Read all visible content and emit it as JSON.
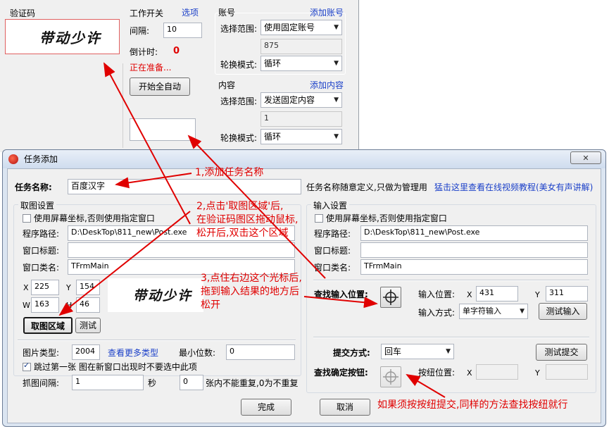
{
  "background_window": {
    "captcha_label": "验证码",
    "work_switch_label": "工作开关",
    "options_link": "选项",
    "interval_label": "间隔:",
    "interval_value": "10",
    "countdown_label": "倒计时:",
    "countdown_value": "0",
    "status_text": "正在准备...",
    "start_button": "开始全自动",
    "account_group": "账号",
    "add_account_link": "添加账号",
    "account_scope_label": "选择范围:",
    "account_scope_value": "使用固定账号",
    "account_value": "875",
    "account_rotate_label": "轮换模式:",
    "account_rotate_value": "循环",
    "content_group": "内容",
    "add_content_link": "添加内容",
    "content_scope_label": "选择范围:",
    "content_scope_value": "发送固定内容",
    "content_value": "1",
    "content_rotate_label": "轮换模式:",
    "content_rotate_value": "循环",
    "captcha_text": "带动少许"
  },
  "dialog": {
    "title": "任务添加",
    "close_glyph": "✕",
    "task_name_label": "任务名称:",
    "task_name_value": "百度汉字",
    "task_name_hint": "任务名称随意定义,只做为管理用",
    "video_link": "猛击这里查看在线视频教程(美女有声讲解)",
    "capture": {
      "group_title": "取图设置",
      "use_screen_coords": "使用屏幕坐标,否则使用指定窗口",
      "program_path_label": "程序路径:",
      "program_path_value": "D:\\DeskTop\\811_new\\Post.exe",
      "window_title_label": "窗口标题:",
      "window_title_value": "",
      "window_class_label": "窗口类名:",
      "window_class_value": "TFrmMain",
      "x_label": "X",
      "x_value": "225",
      "y_label": "Y",
      "y_value": "154",
      "w_label": "W",
      "w_value": "163",
      "h_label": "H",
      "h_value": "46",
      "capture_button": "取图区域",
      "test_button": "测试",
      "image_type_label": "图片类型:",
      "image_type_value": "2004",
      "more_types_link": "查看更多类型",
      "min_digits_label": "最小位数:",
      "min_digits_value": "0",
      "skip_first_label": "跳过第一张 图在新窗口出现时不要选中此项",
      "skip_first_checked": true,
      "interval_label": "抓图间隔:",
      "interval_value": "1",
      "seconds_label": "秒",
      "repeat_value": "0",
      "repeat_hint": "张内不能重复,0为不重复",
      "preview_text": "带动少许"
    },
    "input": {
      "group_title": "输入设置",
      "use_screen_coords": "使用屏幕坐标,否则使用指定窗口",
      "program_path_label": "程序路径:",
      "program_path_value": "D:\\DeskTop\\811_new\\Post.exe",
      "window_title_label": "窗口标题:",
      "window_title_value": "",
      "window_class_label": "窗口类名:",
      "window_class_value": "TFrmMain",
      "find_input_label": "查找输入位置:",
      "input_pos_label": "输入位置:",
      "x_label": "X",
      "x_value": "431",
      "y_label": "Y",
      "y_value": "311",
      "input_method_label": "输入方式:",
      "input_method_value": "单字符输入",
      "test_input_button": "测试输入",
      "submit_method_label": "提交方式:",
      "submit_method_value": "回车",
      "test_submit_button": "测试提交",
      "find_button_label": "查找确定按钮:",
      "button_pos_label": "按纽位置:",
      "bx_label": "X",
      "bx_value": "",
      "by_label": "Y",
      "by_value": ""
    },
    "ok_button": "完成",
    "cancel_button": "取消"
  },
  "annotations": {
    "step1": "1,添加任务名称",
    "step2_line1": "2,点击'取图区域'后,",
    "step2_line2": "在验证码图区拖动鼠标,",
    "step2_line3": "松开后,双击这个区域",
    "step3_line1": "3,点住右边这个光标后,",
    "step3_line2": "拖到输入结果的地方后",
    "step3_line3": "松开",
    "step4": "如果须按按纽提交,同样的方法查找按纽就行",
    "color": "#e00000"
  }
}
